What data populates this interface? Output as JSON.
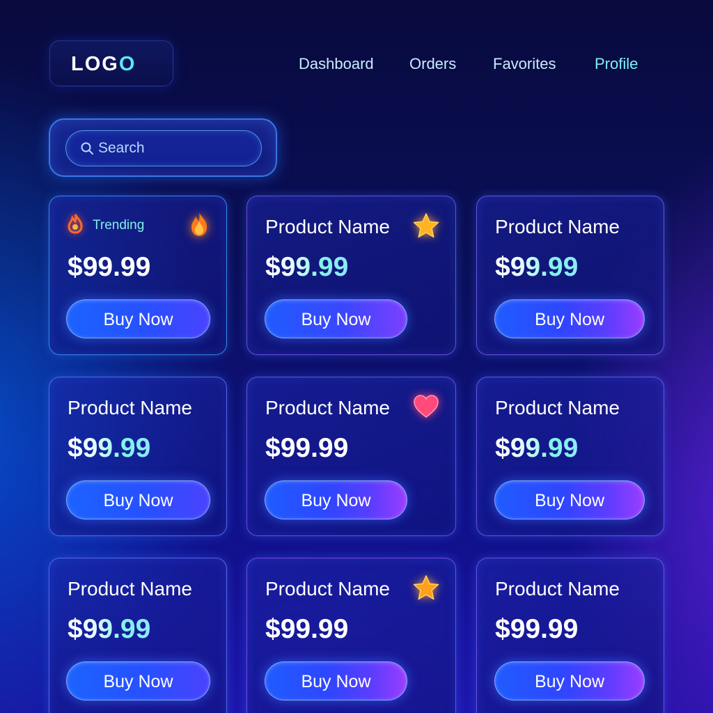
{
  "header": {
    "logo_main": "LOG",
    "logo_accent": "O",
    "nav": [
      {
        "label": "Dashboard"
      },
      {
        "label": "Orders"
      },
      {
        "label": "Favorites"
      },
      {
        "label": "Profile"
      }
    ]
  },
  "search": {
    "placeholder": "Search",
    "icon": "search-icon"
  },
  "colors": {
    "accent_cyan": "#5ee8f2",
    "mint_price": "#7ff3e6",
    "button_blue": "#1f5cff",
    "button_purple": "#9a3dff",
    "fire_orange": "#ff8a1f",
    "star_gold": "#ffb320",
    "heart_pink": "#ff4a7a"
  },
  "products": [
    {
      "trending_label": "Trending",
      "price": "$99.99",
      "button": "Buy Now",
      "badge": "fire-icon"
    },
    {
      "name": "Product Name",
      "price": "$99.99",
      "button": "Buy Now",
      "badge": "star-icon"
    },
    {
      "name": "Product Name",
      "price": "$99.99",
      "button": "Buy Now",
      "badge": ""
    },
    {
      "name": "Product Name",
      "price": "$99.99",
      "button": "Buy Now",
      "badge": ""
    },
    {
      "name": "Product Name",
      "price": "$99.99",
      "button": "Buy Now",
      "badge": "heart-icon"
    },
    {
      "name": "Product Name",
      "price": "$99.99",
      "button": "Buy Now",
      "badge": ""
    },
    {
      "name": "Product Name",
      "price": "$99.99",
      "button": "Buy Now",
      "badge": ""
    },
    {
      "name": "Product Name",
      "price": "$99.99",
      "button": "Buy Now",
      "badge": "star-icon"
    },
    {
      "name": "Product Name",
      "price": "$99.99",
      "button": "Buy Now",
      "badge": ""
    }
  ]
}
